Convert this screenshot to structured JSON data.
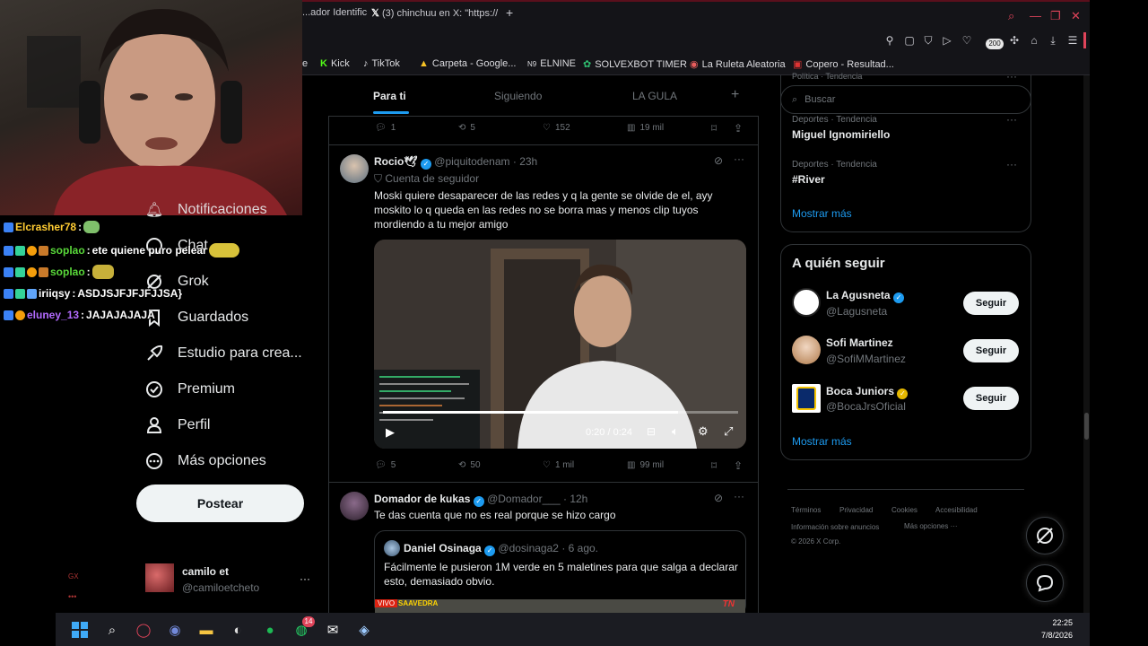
{
  "browser": {
    "tabs": [
      {
        "label": "...ador Identific"
      },
      {
        "label": "(3) chinchuu en X: \"https://"
      }
    ],
    "new_tab": "+",
    "extension_badge": "200",
    "bookmarks": [
      {
        "label": "e"
      },
      {
        "label": "Kick"
      },
      {
        "label": "TikTok"
      },
      {
        "label": "Carpeta - Google..."
      },
      {
        "label": "ELNINE"
      },
      {
        "label": "SOLVEXBOT TIMER"
      },
      {
        "label": "La Ruleta Aleatoria"
      },
      {
        "label": "Copero - Resultad..."
      }
    ]
  },
  "stream_chat": [
    {
      "user": "Elcrasher78",
      "msg": "",
      "color": "#ffcc33"
    },
    {
      "user": "soplao",
      "msg": "ete quiene puro pelear",
      "color": "#59d93a"
    },
    {
      "user": "soplao",
      "msg": "",
      "color": "#59d93a"
    },
    {
      "user": "iriiqsy",
      "msg": "ASDJSJFJFJFJJSA}",
      "color": "#ffffff"
    },
    {
      "user": "eluney_13",
      "msg": "JAJAJAJAJA",
      "color": "#b36bff"
    }
  ],
  "nav": {
    "items": [
      {
        "label": "Notificaciones",
        "icon": "bell-icon"
      },
      {
        "label": "Chat",
        "icon": "chat-icon"
      },
      {
        "label": "Grok",
        "icon": "grok-icon"
      },
      {
        "label": "Guardados",
        "icon": "bookmark-icon"
      },
      {
        "label": "Estudio para crea...",
        "icon": "rocket-icon"
      },
      {
        "label": "Premium",
        "icon": "premium-icon"
      },
      {
        "label": "Perfil",
        "icon": "person-icon"
      },
      {
        "label": "Más opciones",
        "icon": "more-circle-icon"
      }
    ],
    "post_button": "Postear",
    "account": {
      "name": "camilo et",
      "handle": "@camiloetcheto",
      "more": "···"
    }
  },
  "feed": {
    "tabs": [
      {
        "label": "Para ti",
        "active": true
      },
      {
        "label": "Siguiendo",
        "active": false
      },
      {
        "label": "LA GULA",
        "active": false
      }
    ],
    "add_tab": "+",
    "prev_actions": {
      "replies": "1",
      "reposts": "5",
      "likes": "152",
      "views": "19 mil"
    },
    "post1": {
      "name": "Rocio🕊",
      "handle": "@piquitodenam",
      "time": "23h",
      "tag": "Cuenta de seguidor",
      "text": "Moski quiere desaparecer de las redes y q la gente se olvide de el, ayy moskito lo q queda en las redes no se borra mas y menos clip tuyos mordiendo a tu mejor amigo",
      "video_time": "0:20 / 0:24",
      "video_progress": 0.83,
      "actions": {
        "replies": "5",
        "reposts": "50",
        "likes": "1 mil",
        "views": "99 mil"
      }
    },
    "post2": {
      "name": "Domador de kukas",
      "handle": "@Domador___",
      "time": "12h",
      "text": "Te das cuenta que no es real porque se hizo cargo",
      "quote": {
        "name": "Daniel Osinaga",
        "handle": "@dosinaga2",
        "time": "6 ago.",
        "text": "Fácilmente le pusieron 1M verde en 5 maletines para que salga a declarar esto, demasiado obvio.",
        "live_label": "VIVO",
        "live_place": "SAAVEDRA",
        "channel": "TN"
      }
    }
  },
  "sidebar": {
    "search_placeholder": "Buscar",
    "trends_header_cut": "Política · Tendencia",
    "trends": [
      {
        "category": "Deportes · Tendencia",
        "topic": "Miguel Ignomiriello"
      },
      {
        "category": "Deportes · Tendencia",
        "topic": "#River"
      }
    ],
    "trends_more": "Mostrar más",
    "who_to_follow": {
      "title": "A quién seguir",
      "accounts": [
        {
          "name": "La Agusneta",
          "handle": "@Lagusneta",
          "verified": "blue"
        },
        {
          "name": "Sofi Martinez",
          "handle": "@SofiMMartinez",
          "verified": "none"
        },
        {
          "name": "Boca Juniors",
          "handle": "@BocaJrsOficial",
          "verified": "gold"
        }
      ],
      "follow_label": "Seguir",
      "more": "Mostrar más"
    },
    "footer": {
      "links": [
        "Términos",
        "Privacidad",
        "Cookies",
        "Accesibilidad",
        "Información sobre anuncios",
        "Más opciones ···"
      ],
      "copyright": "© 2026 X Corp."
    }
  },
  "taskbar": {
    "time": "22:25",
    "date": "7/8/2026",
    "whatsapp_badge": "14"
  }
}
